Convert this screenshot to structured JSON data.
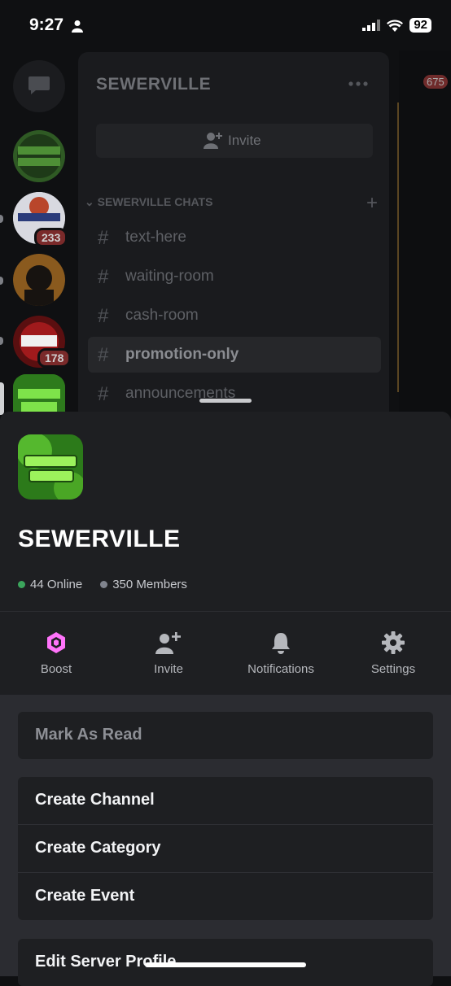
{
  "status_bar": {
    "time": "9:27",
    "battery": "92"
  },
  "background": {
    "server_name": "SEWERVILLE",
    "invite_label": "Invite",
    "category": "SEWERVILLE CHATS",
    "channels": [
      "text-here",
      "waiting-room",
      "cash-room",
      "promotion-only",
      "announcements"
    ],
    "active_channel_index": 3,
    "rail_badges": [
      "233",
      "178"
    ],
    "right_badge": "675"
  },
  "sheet": {
    "server_name": "SEWERVILLE",
    "online": "44 Online",
    "members": "350 Members",
    "actions": [
      {
        "label": "Boost",
        "icon": "boost-icon"
      },
      {
        "label": "Invite",
        "icon": "invite-icon"
      },
      {
        "label": "Notifications",
        "icon": "bell-icon"
      },
      {
        "label": "Settings",
        "icon": "gear-icon"
      }
    ],
    "menu_group_1": [
      "Mark As Read"
    ],
    "menu_group_2": [
      "Create Channel",
      "Create Category",
      "Create Event"
    ],
    "menu_group_3": [
      "Edit Server Profile"
    ]
  },
  "colors": {
    "online": "#3ba55c",
    "members": "#80848e",
    "boost": "#ff73fa",
    "accent": "#5865f2"
  }
}
